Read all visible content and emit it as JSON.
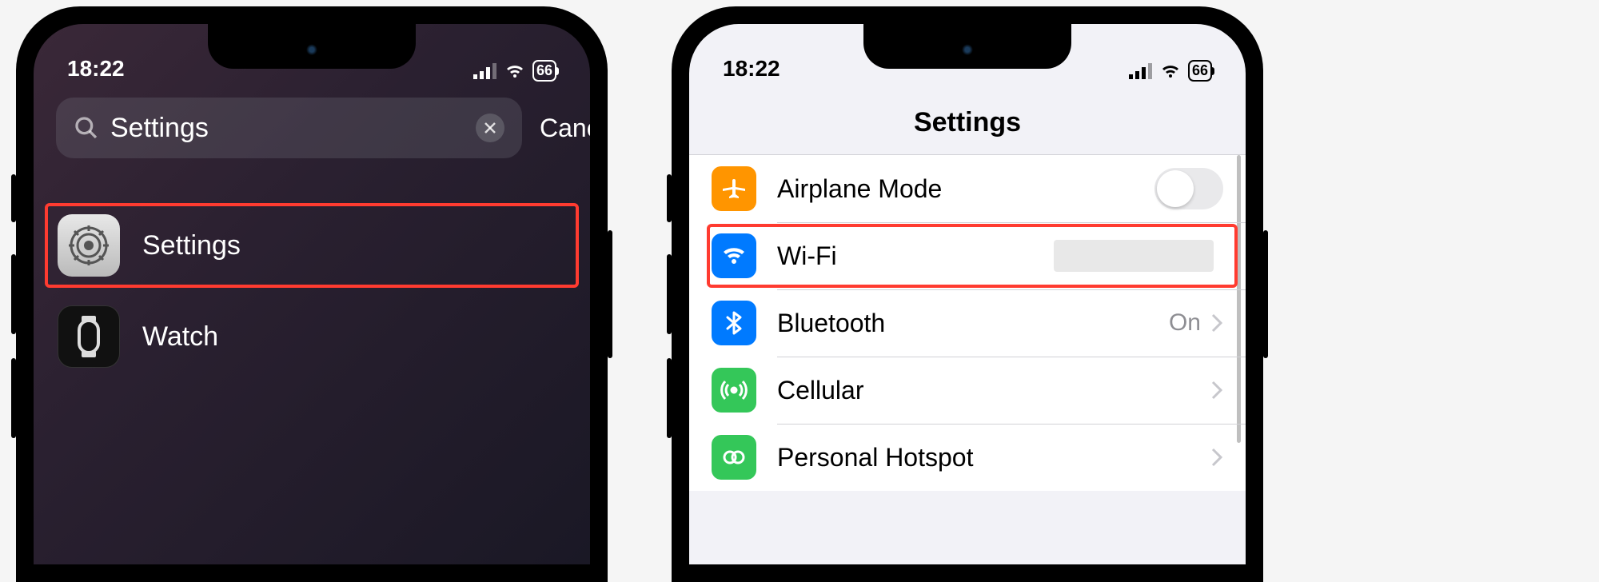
{
  "left": {
    "status": {
      "time": "18:22",
      "battery": "66"
    },
    "search": {
      "value": "Settings",
      "cancel": "Cancel"
    },
    "results": [
      {
        "label": "Settings",
        "icon": "settings-icon"
      },
      {
        "label": "Watch",
        "icon": "watch-icon"
      }
    ]
  },
  "right": {
    "status": {
      "time": "18:22",
      "battery": "66"
    },
    "title": "Settings",
    "rows": [
      {
        "label": "Airplane Mode",
        "icon": "airplane-icon",
        "value": "",
        "switch": true
      },
      {
        "label": "Wi-Fi",
        "icon": "wifi-icon",
        "value": ""
      },
      {
        "label": "Bluetooth",
        "icon": "bluetooth-icon",
        "value": "On"
      },
      {
        "label": "Cellular",
        "icon": "cellular-icon",
        "value": ""
      },
      {
        "label": "Personal Hotspot",
        "icon": "hotspot-icon",
        "value": ""
      }
    ]
  }
}
